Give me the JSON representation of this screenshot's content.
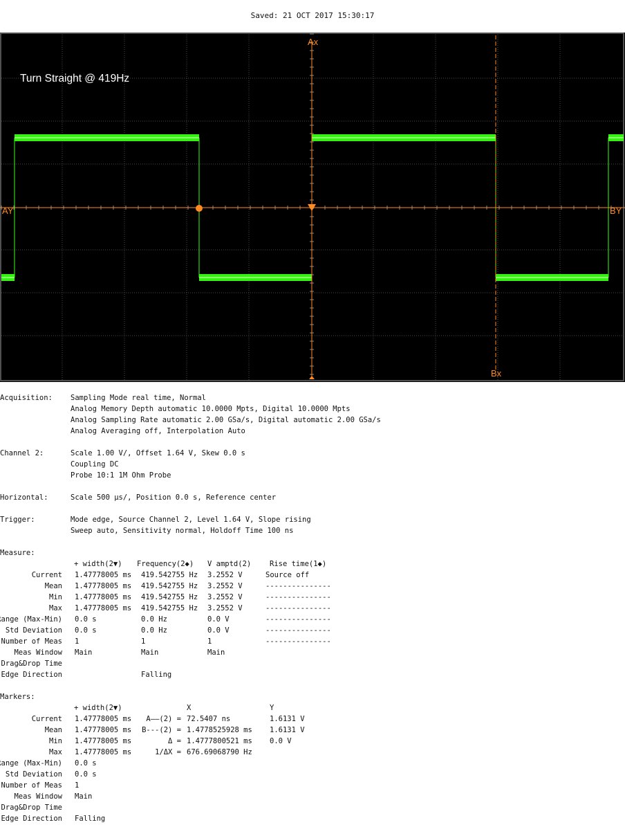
{
  "saved_label": "Saved:  21 OCT 2017  15:30:17",
  "colors": {
    "trace": "#39ff14",
    "marker": "#ff8a1f",
    "grid": "#4a4a4a",
    "screen_bg": "#000000"
  },
  "screen": {
    "annotation": "Turn Straight @ 419Hz",
    "marker_labels": {
      "ax": "Ax",
      "bx": "Bx",
      "ay": "AY",
      "by": "BY"
    }
  },
  "acquisition": {
    "label": "Acquisition:",
    "lines": [
      "Sampling Mode real time, Normal",
      "Analog Memory Depth automatic 10.0000 Mpts, Digital 10.0000 Mpts",
      "Analog Sampling Rate automatic 2.00 GSa/s, Digital automatic 2.00 GSa/s",
      "Analog Averaging off, Interpolation Auto"
    ]
  },
  "channel2": {
    "label": "Channel 2:",
    "lines": [
      "Scale 1.00 V/, Offset 1.64 V, Skew 0.0 s",
      "Coupling DC",
      "Probe 10:1 1M Ohm Probe"
    ]
  },
  "horizontal": {
    "label": "Horizontal:",
    "lines": [
      "Scale 500 µs/, Position 0.0 s, Reference center"
    ]
  },
  "trigger": {
    "label": "Trigger:",
    "lines": [
      "Mode edge, Source Channel 2, Level 1.64 V, Slope rising",
      "Sweep auto, Sensitivity normal, Holdoff Time 100 ns"
    ]
  },
  "measure": {
    "label": "Measure:",
    "headers": [
      "+ width(2▼)",
      "Frequency(2◆)",
      "V amptd(2)",
      "Rise time(1◆)"
    ],
    "rows": [
      {
        "label": "Current",
        "cells": [
          "1.47778005 ms",
          "419.542755 Hz",
          "3.2552 V",
          "Source off"
        ]
      },
      {
        "label": "Mean",
        "cells": [
          "1.47778005 ms",
          "419.542755 Hz",
          "3.2552 V",
          "---------------"
        ]
      },
      {
        "label": "Min",
        "cells": [
          "1.47778005 ms",
          "419.542755 Hz",
          "3.2552 V",
          "---------------"
        ]
      },
      {
        "label": "Max",
        "cells": [
          "1.47778005 ms",
          "419.542755 Hz",
          "3.2552 V",
          "---------------"
        ]
      },
      {
        "label": "Range (Max-Min)",
        "cells": [
          "0.0 s",
          "0.0 Hz",
          "0.0 V",
          "---------------"
        ]
      },
      {
        "label": "Std Deviation",
        "cells": [
          "0.0 s",
          "0.0 Hz",
          "0.0 V",
          "---------------"
        ]
      },
      {
        "label": "Number of Meas",
        "cells": [
          "1",
          "1",
          "1",
          "---------------"
        ]
      },
      {
        "label": "Meas Window",
        "cells": [
          "Main",
          "Main",
          "Main",
          ""
        ]
      },
      {
        "label": "Drag&Drop Time",
        "cells": [
          "",
          "",
          "",
          ""
        ]
      },
      {
        "label": "Edge Direction",
        "cells": [
          "",
          "Falling",
          "",
          ""
        ]
      }
    ]
  },
  "markers": {
    "label": "Markers:",
    "col_header": "+ width(2▼)",
    "x_header": "X",
    "y_header": "Y",
    "rows": [
      {
        "label": "Current",
        "value": "1.47778005 ms",
        "key": "A——(2) =",
        "x": "72.5407 ns",
        "y": "1.6131 V"
      },
      {
        "label": "Mean",
        "value": "1.47778005 ms",
        "key": "B---(2) =",
        "x": "1.4778525928 ms",
        "y": "1.6131 V"
      },
      {
        "label": "Min",
        "value": "1.47778005 ms",
        "key": "Δ =",
        "x": "1.4777800521 ms",
        "y": "0.0 V"
      },
      {
        "label": "Max",
        "value": "1.47778005 ms",
        "key": "1/ΔX =",
        "x": "676.69068790 Hz",
        "y": ""
      },
      {
        "label": "Range (Max-Min)",
        "value": "0.0 s",
        "key": "",
        "x": "",
        "y": ""
      },
      {
        "label": "Std Deviation",
        "value": "0.0 s",
        "key": "",
        "x": "",
        "y": ""
      },
      {
        "label": "Number of Meas",
        "value": "1",
        "key": "",
        "x": "",
        "y": ""
      },
      {
        "label": "Meas Window",
        "value": "Main",
        "key": "",
        "x": "",
        "y": ""
      },
      {
        "label": "Drag&Drop Time",
        "value": "",
        "key": "",
        "x": "",
        "y": ""
      },
      {
        "label": "Edge Direction",
        "value": "Falling",
        "key": "",
        "x": "",
        "y": ""
      }
    ]
  }
}
